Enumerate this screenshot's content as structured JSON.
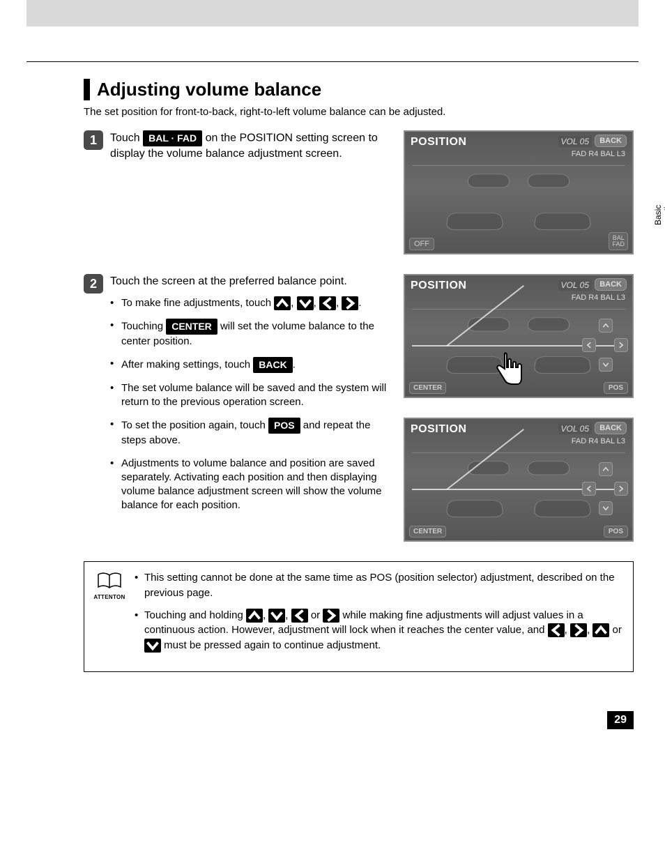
{
  "sidebar": {
    "label1": "Basic",
    "label2": "operation"
  },
  "section": {
    "title": "Adjusting volume balance",
    "intro": "The set position for front-to-back, right-to-left volume balance can be adjusted."
  },
  "steps": {
    "s1": {
      "num": "1",
      "pre": "Touch ",
      "btn": "BAL · FAD",
      "post": " on the POSITION setting screen to display the volume balance adjustment screen."
    },
    "s2": {
      "num": "2",
      "lead": "Touch the screen at the preferred balance point.",
      "b1a": "To make fine adjustments, touch ",
      "comma": ", ",
      "period": ".",
      "b2a": "Touching ",
      "b2btn": "CENTER",
      "b2b": " will set the volume balance to the center position.",
      "b3a": "After making settings, touch ",
      "b3btn": "BACK",
      "b4": "The set volume balance will be saved and the system will return to the previous operation screen.",
      "b5a": "To set the position again, touch ",
      "b5btn": "POS",
      "b5b": " and repeat the steps above.",
      "b6": "Adjustments to volume balance and position are saved separately. Activating each position and then displaying volume balance adjustment screen will show the volume balance for each position."
    }
  },
  "shots": {
    "title": "POSITION",
    "vol": "VOL 05",
    "back": "BACK",
    "fadbal": "FAD R4   BAL L3",
    "off": "OFF",
    "balfad1": "BAL",
    "balfad2": "FAD",
    "center": "CENTER",
    "pos": "POS"
  },
  "attention": {
    "label": "ATTENTON",
    "a1": "This setting cannot be done at the same time as POS (position selector) adjustment, described on the previous page.",
    "a2a": "Touching and holding ",
    "a2b": " while making fine adjustments will adjust values in a continuous action.  However, adjustment will lock when it reaches the center value, and ",
    "a2or": " or ",
    "a2c": " must be pressed again to continue adjustment.",
    "comma": ", "
  },
  "page_number": "29"
}
